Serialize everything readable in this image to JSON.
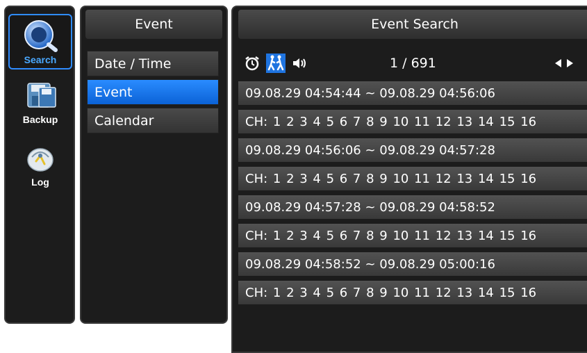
{
  "nav": {
    "items": [
      {
        "label": "Search",
        "icon": "search-icon",
        "active": true
      },
      {
        "label": "Backup",
        "icon": "backup-icon",
        "active": false
      },
      {
        "label": "Log",
        "icon": "log-icon",
        "active": false
      }
    ]
  },
  "event_menu": {
    "title": "Event",
    "items": [
      {
        "label": "Date / Time",
        "selected": false
      },
      {
        "label": "Event",
        "selected": true
      },
      {
        "label": "Calendar",
        "selected": false
      }
    ]
  },
  "event_search": {
    "title": "Event Search",
    "filters": [
      {
        "icon": "alarm-clock-icon",
        "active": false
      },
      {
        "icon": "motion-people-icon",
        "active": true
      },
      {
        "icon": "speaker-icon",
        "active": false
      }
    ],
    "page": "1 / 691",
    "results": [
      {
        "range": "09.08.29  04:54:44  ~  09.08.29  04:56:06",
        "channels": "CH: 1  2  3  4  5  6  7  8  9  10  11  12  13  14  15  16"
      },
      {
        "range": "09.08.29  04:56:06  ~  09.08.29  04:57:28",
        "channels": "CH: 1  2  3  4  5  6  7  8  9  10  11  12  13  14  15  16"
      },
      {
        "range": "09.08.29  04:57:28  ~  09.08.29  04:58:52",
        "channels": "CH: 1  2  3  4  5  6  7  8  9  10  11  12  13  14  15  16"
      },
      {
        "range": "09.08.29  04:58:52  ~  09.08.29  05:00:16",
        "channels": "CH: 1  2  3  4  5  6  7  8  9  10  11  12  13  14  15  16"
      }
    ]
  },
  "colors": {
    "accent": "#1f74e0",
    "panel": "#1c1c1c",
    "row": "#454545"
  }
}
